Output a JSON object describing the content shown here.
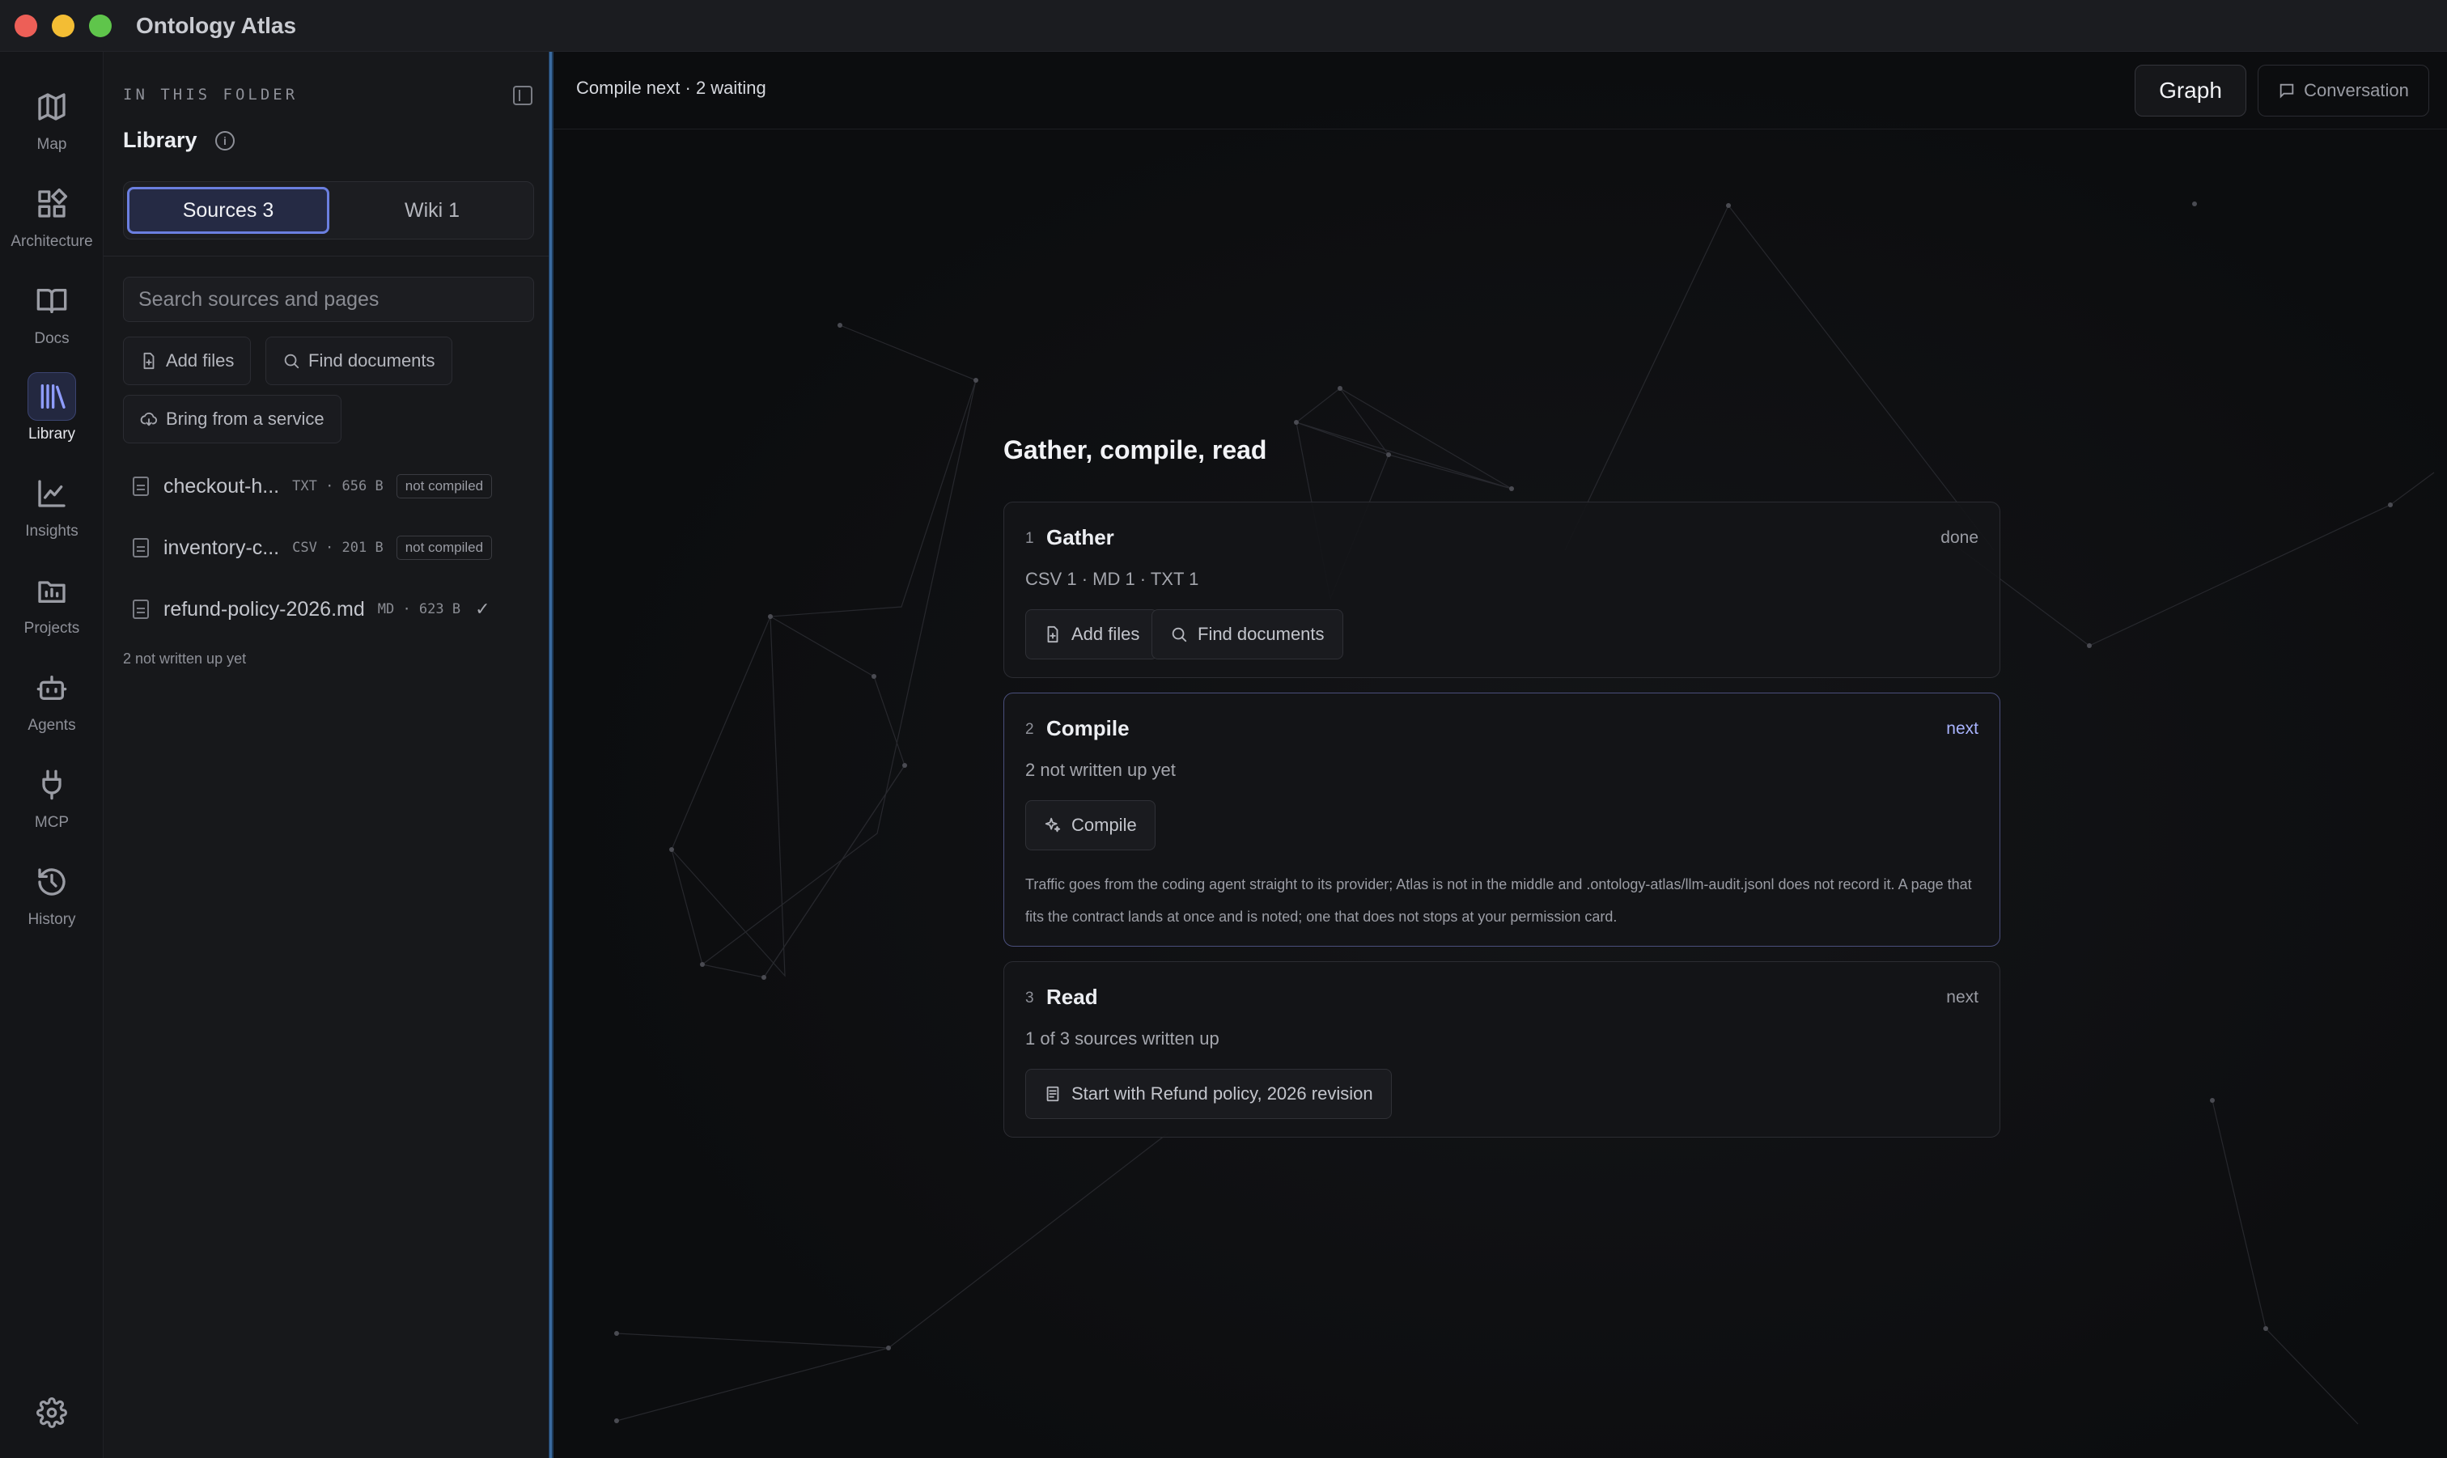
{
  "app": {
    "title": "Ontology Atlas"
  },
  "rail": {
    "items": [
      {
        "label": "Map",
        "icon": "map-icon"
      },
      {
        "label": "Architecture",
        "icon": "architecture-icon"
      },
      {
        "label": "Docs",
        "icon": "book-icon"
      },
      {
        "label": "Library",
        "icon": "library-icon",
        "active": true
      },
      {
        "label": "Insights",
        "icon": "chart-line-icon"
      },
      {
        "label": "Projects",
        "icon": "folder-icon"
      },
      {
        "label": "Agents",
        "icon": "robot-icon"
      },
      {
        "label": "MCP",
        "icon": "plug-icon"
      },
      {
        "label": "History",
        "icon": "history-icon"
      }
    ],
    "settings_icon": "gear-icon"
  },
  "library": {
    "folder_label": "IN THIS FOLDER",
    "title": "Library",
    "tabs": {
      "sources": "Sources 3",
      "wiki": "Wiki 1"
    },
    "search_placeholder": "Search sources and pages",
    "actions": {
      "add_files": "Add files",
      "find_documents": "Find documents",
      "bring_from_service": "Bring from a service"
    },
    "files": [
      {
        "name": "checkout-h...",
        "meta": "TXT · 656 B",
        "badge": "not compiled"
      },
      {
        "name": "inventory-c...",
        "meta": "CSV · 201 B",
        "badge": "not compiled"
      },
      {
        "name": "refund-policy-2026.md",
        "meta": "MD · 623 B",
        "badge": "✓"
      }
    ],
    "footer": "2 not written up yet"
  },
  "main": {
    "status": "Compile next · 2 waiting",
    "tabs": {
      "graph": "Graph",
      "conversation": "Conversation"
    },
    "flow_title": "Gather, compile, read",
    "steps": [
      {
        "num": "1",
        "title": "Gather",
        "state": "done",
        "sub": "CSV 1 · MD 1 · TXT 1",
        "buttons": [
          "Add files",
          "Find documents"
        ]
      },
      {
        "num": "2",
        "title": "Compile",
        "state": "next",
        "sub": "2 not written up yet",
        "button": "Compile",
        "note": "Traffic goes from the coding agent straight to its provider; Atlas is not in the middle and .ontology-atlas/llm-audit.jsonl does not record it. A page that fits the contract lands at once and is noted; one that does not stops at your permission card."
      },
      {
        "num": "3",
        "title": "Read",
        "state": "next",
        "sub": "1 of 3 sources written up",
        "button": "Start with Refund policy, 2026 revision"
      }
    ]
  },
  "colors": {
    "accent": "#6b7fe0",
    "background": "#0c0d0f",
    "panel": "#17181b"
  }
}
